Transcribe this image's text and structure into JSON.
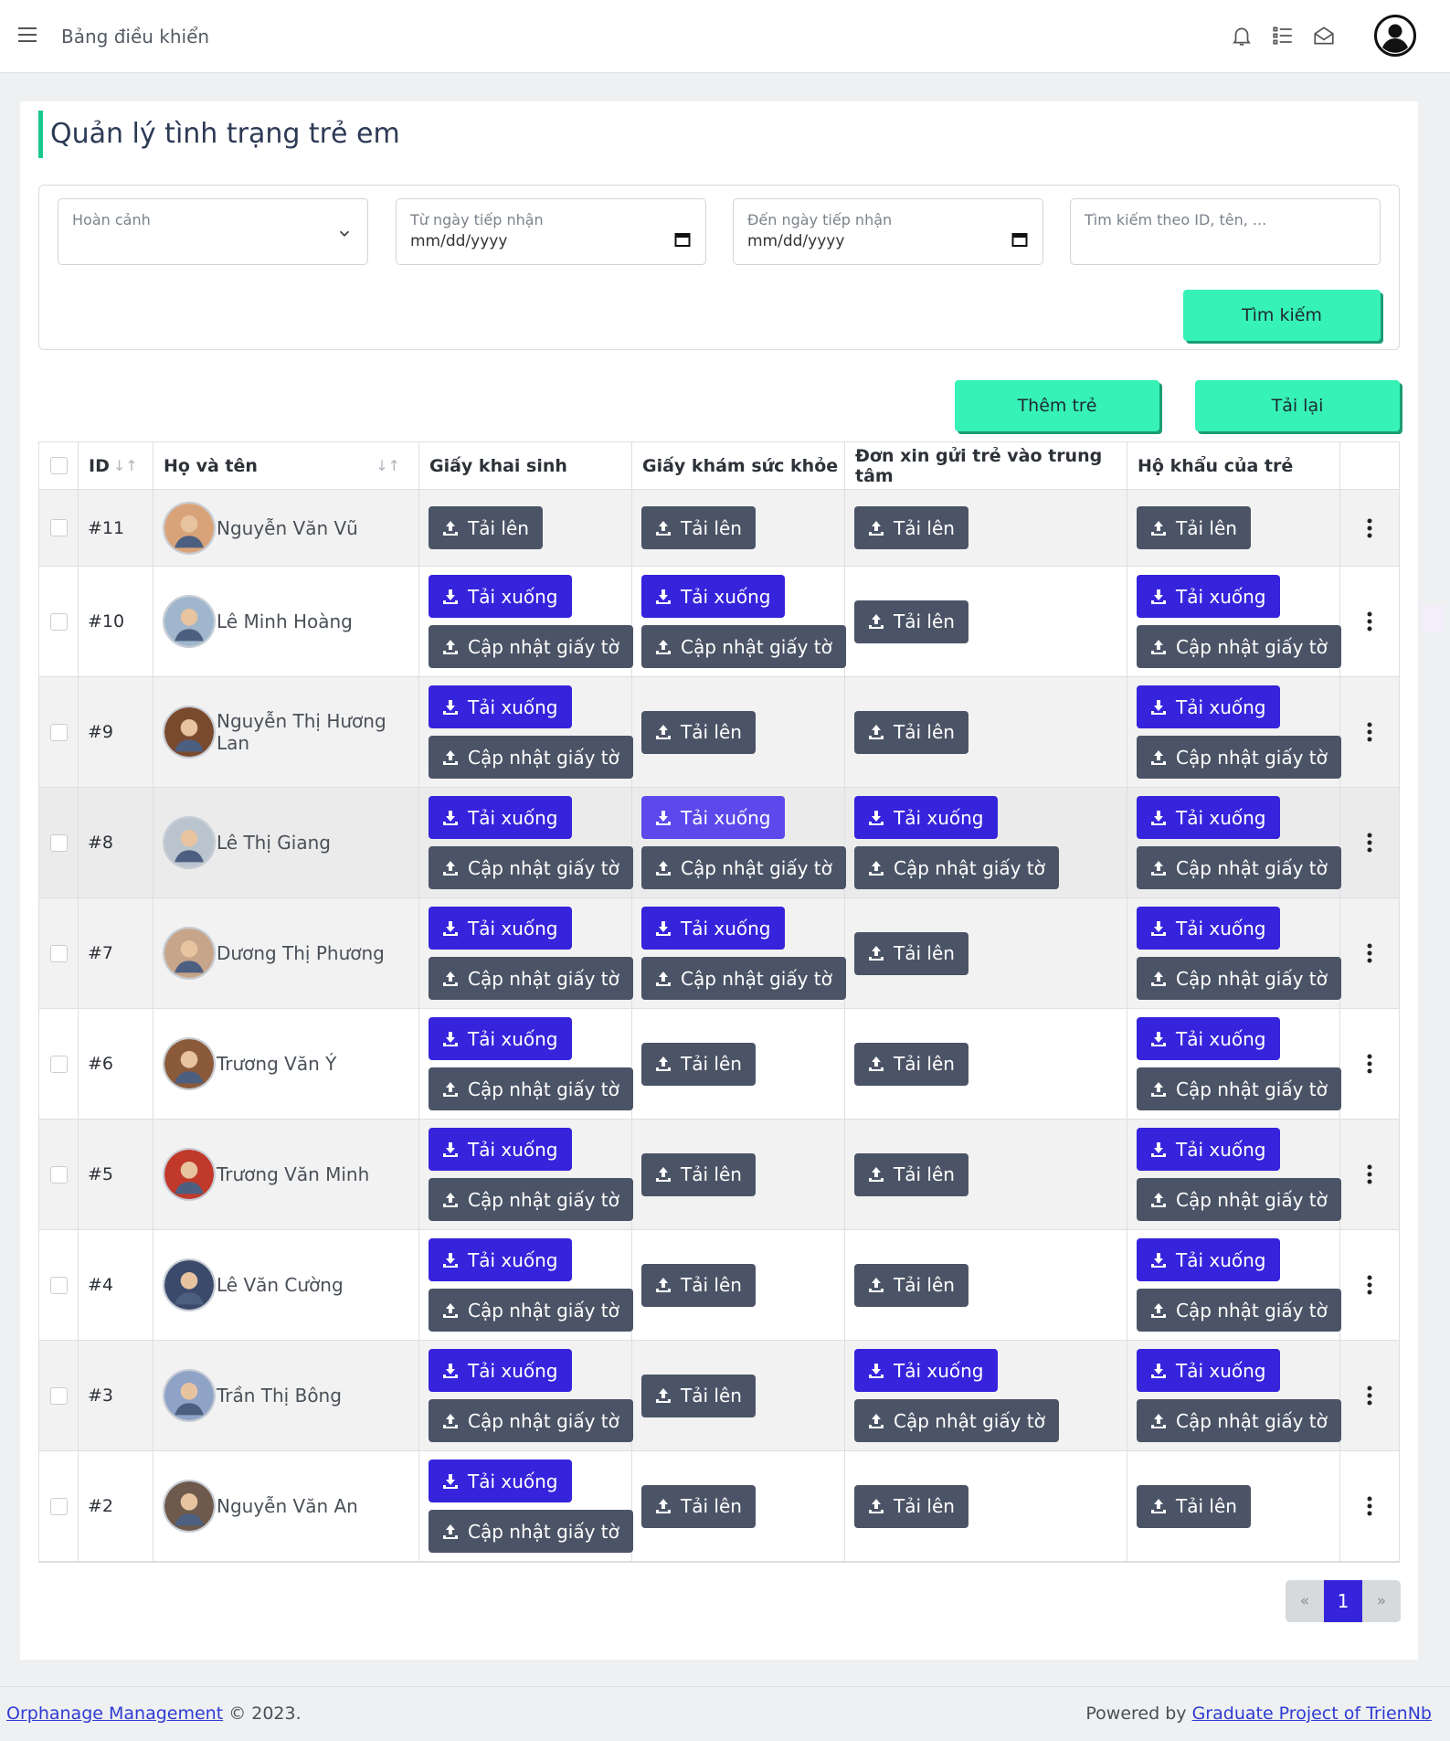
{
  "topbar": {
    "title": "Bảng điều khiển",
    "icons": [
      "bell-icon",
      "list-icon",
      "mail-icon",
      "user-avatar-icon"
    ]
  },
  "page": {
    "title": "Quản lý tình trạng trẻ em"
  },
  "filters": {
    "circumstance": {
      "placeholder": "Hoàn cảnh"
    },
    "from_date": {
      "label": "Từ ngày tiếp nhận",
      "value": "mm/dd/yyyy"
    },
    "to_date": {
      "label": "Đến ngày tiếp nhận",
      "value": "mm/dd/yyyy"
    },
    "search": {
      "placeholder": "Tìm kiếm theo ID, tên, ..."
    },
    "search_button": "Tìm kiếm"
  },
  "actions": {
    "add_child": "Thêm trẻ",
    "reload": "Tải lại"
  },
  "buttons": {
    "upload": "Tải lên",
    "download": "Tải xuống",
    "update": "Cập nhật giấy tờ"
  },
  "table": {
    "headers": {
      "id": "ID",
      "name": "Họ và tên",
      "birth_cert": "Giấy khai sinh",
      "health_cert": "Giấy khám sức khỏe",
      "application": "Đơn xin gửi trẻ vào trung tâm",
      "household": "Hộ khẩu của trẻ"
    },
    "sort_glyph": "↓↑",
    "rows": [
      {
        "id": "#11",
        "name": "Nguyễn Văn Vũ",
        "birth": false,
        "health": false,
        "app": false,
        "house": false
      },
      {
        "id": "#10",
        "name": "Lê Minh Hoàng",
        "birth": true,
        "health": true,
        "app": false,
        "house": true
      },
      {
        "id": "#9",
        "name": "Nguyễn Thị Hương Lan",
        "birth": true,
        "health": false,
        "app": false,
        "house": true
      },
      {
        "id": "#8",
        "name": "Lê Thị Giang",
        "birth": true,
        "health": true,
        "app": true,
        "house": true
      },
      {
        "id": "#7",
        "name": "Dương Thị Phương",
        "birth": true,
        "health": true,
        "app": false,
        "house": true
      },
      {
        "id": "#6",
        "name": "Trương Văn Ý",
        "birth": true,
        "health": false,
        "app": false,
        "house": true
      },
      {
        "id": "#5",
        "name": "Trương Văn Minh",
        "birth": true,
        "health": false,
        "app": false,
        "house": true
      },
      {
        "id": "#4",
        "name": "Lê Văn Cường",
        "birth": true,
        "health": false,
        "app": false,
        "house": true
      },
      {
        "id": "#3",
        "name": "Trần Thị Bông",
        "birth": true,
        "health": false,
        "app": true,
        "house": true
      },
      {
        "id": "#2",
        "name": "Nguyễn Văn An",
        "birth": true,
        "health": false,
        "app": false,
        "house": false
      }
    ]
  },
  "pagination": {
    "prev": "«",
    "current": "1",
    "next": "»"
  },
  "footer": {
    "left_link": "Orphanage Management",
    "left_suffix": " © 2023.",
    "right_prefix": "Powered by ",
    "right_link": "Graduate Project of TrienNb"
  },
  "colors": {
    "accent_green": "#36f2b6",
    "download_blue": "#3623dc",
    "upload_gray": "#4b5466",
    "title_bar": "#17c98c"
  }
}
